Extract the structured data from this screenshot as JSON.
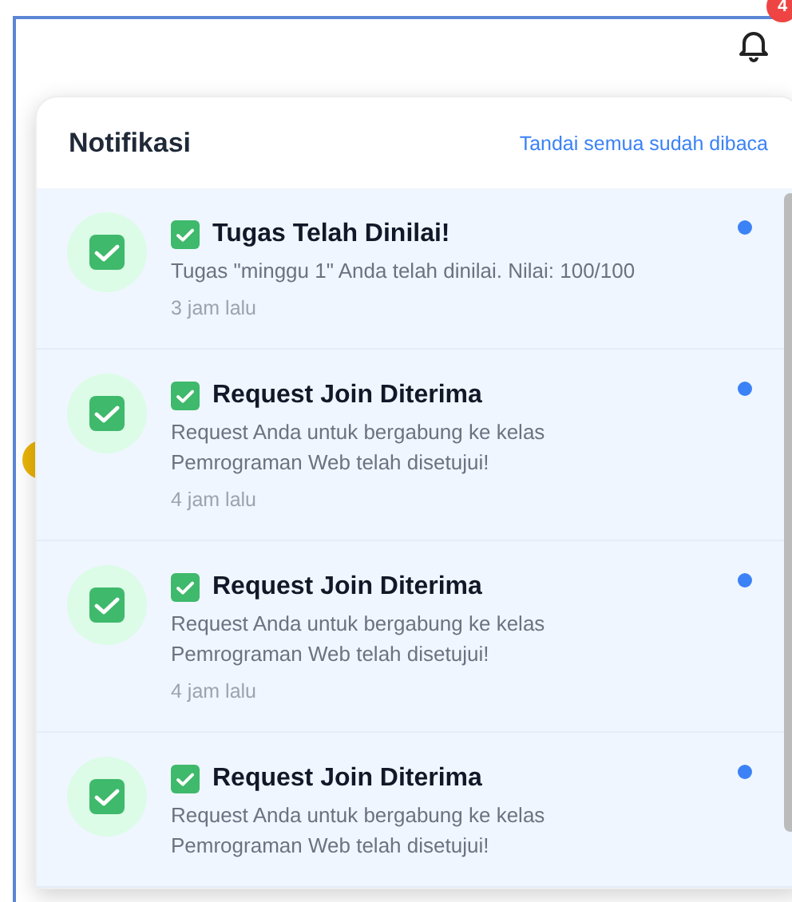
{
  "header": {
    "badge": "4"
  },
  "panel": {
    "title": "Notifikasi",
    "mark_all_link": "Tandai semua sudah dibaca"
  },
  "notifications": [
    {
      "title": "Tugas Telah Dinilai!",
      "message": "Tugas \"minggu 1\" Anda telah dinilai. Nilai: 100/100",
      "time": "3 jam lalu",
      "unread": true
    },
    {
      "title": "Request Join Diterima",
      "message": "Request Anda untuk bergabung ke kelas Pemrograman Web telah disetujui!",
      "time": "4 jam lalu",
      "unread": true
    },
    {
      "title": "Request Join Diterima",
      "message": "Request Anda untuk bergabung ke kelas Pemrograman Web telah disetujui!",
      "time": "4 jam lalu",
      "unread": true
    },
    {
      "title": "Request Join Diterima",
      "message": "Request Anda untuk bergabung ke kelas Pemrograman Web telah disetujui!",
      "unread": true
    }
  ]
}
